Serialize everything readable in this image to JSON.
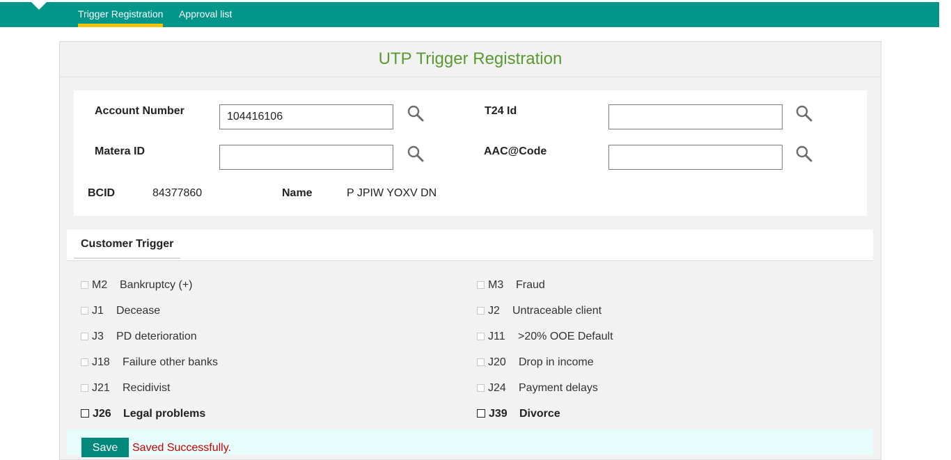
{
  "nav": {
    "tabs": [
      {
        "label": "Trigger Registration",
        "active": true
      },
      {
        "label": "Approval list",
        "active": false
      }
    ]
  },
  "page": {
    "title": "UTP Trigger Registration"
  },
  "form": {
    "account_number": {
      "label": "Account Number",
      "value": "104416106"
    },
    "t24_id": {
      "label": "T24 Id",
      "value": ""
    },
    "matera_id": {
      "label": "Matera ID",
      "value": ""
    },
    "aac_code": {
      "label": "AAC@Code",
      "value": ""
    },
    "bcid": {
      "label": "BCID",
      "value": "84377860"
    },
    "name": {
      "label": "Name",
      "value": "P JPIW YOXV DN"
    }
  },
  "triggers": {
    "tab_label": "Customer Trigger",
    "items": [
      {
        "code": "M2",
        "name": "Bankruptcy (+)",
        "checked": false
      },
      {
        "code": "M3",
        "name": "Fraud",
        "checked": false
      },
      {
        "code": "J1",
        "name": "Decease",
        "checked": false
      },
      {
        "code": "J2",
        "name": "Untraceable client",
        "checked": false
      },
      {
        "code": "J3",
        "name": "PD deterioration",
        "checked": false
      },
      {
        "code": "J11",
        "name": ">20% OOE Default",
        "checked": false
      },
      {
        "code": "J18",
        "name": "Failure other banks",
        "checked": false
      },
      {
        "code": "J20",
        "name": "Drop in income",
        "checked": false
      },
      {
        "code": "J21",
        "name": "Recidivist",
        "checked": false
      },
      {
        "code": "J24",
        "name": "Payment delays",
        "checked": false
      },
      {
        "code": "J26",
        "name": "Legal problems",
        "checked": false
      },
      {
        "code": "J39",
        "name": "Divorce",
        "checked": false
      }
    ]
  },
  "footer": {
    "save_label": "Save",
    "status_message": "Saved Successfully."
  },
  "colors": {
    "brand_teal": "#00968a",
    "active_tab_underline": "#f2c300",
    "title_green": "#5b9a31",
    "error_red": "#cc0000"
  },
  "icons": {
    "search": "magnifier-icon"
  }
}
